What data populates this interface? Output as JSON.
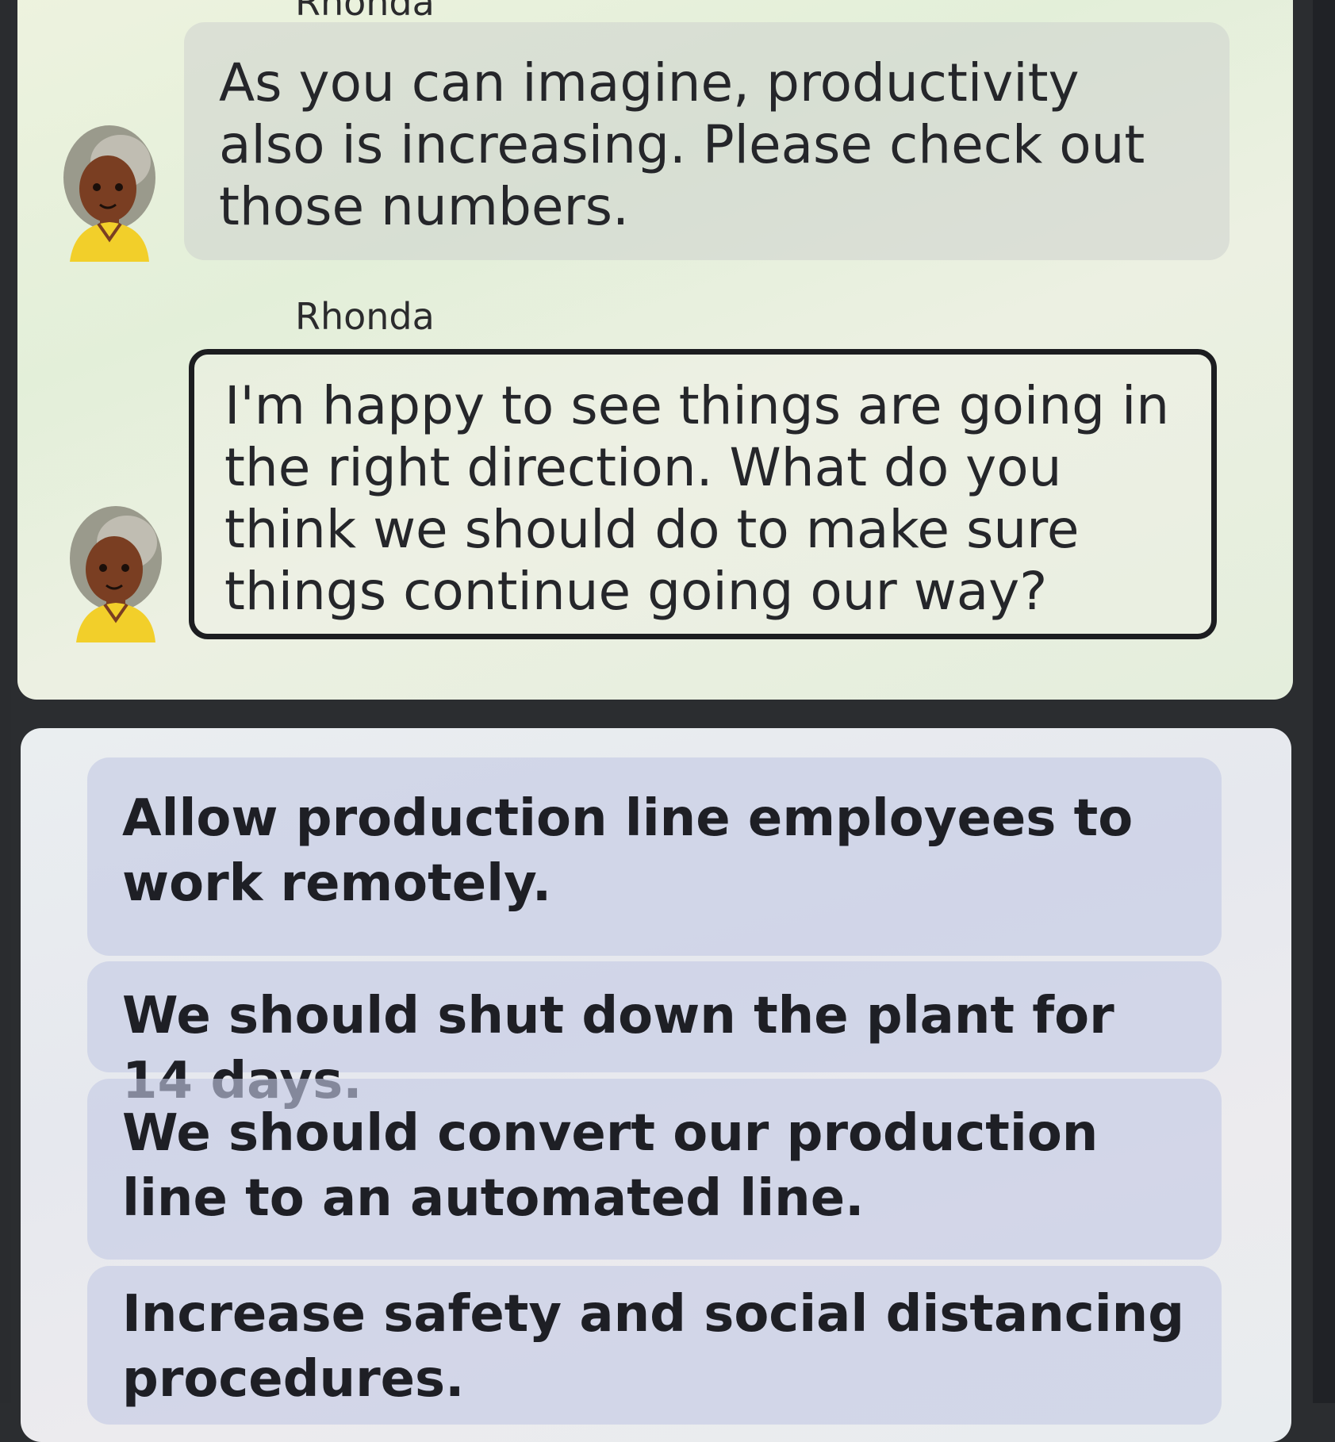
{
  "conversation": {
    "messages": [
      {
        "speaker": "Rhonda",
        "text": "As you can imagine, productivity also is increasing. Please check out those numbers."
      },
      {
        "speaker": "Rhonda",
        "text": "I'm happy to see things are going in the right direction. What do you think we should do to make sure things continue going our way?"
      }
    ]
  },
  "response_options": [
    {
      "text": "Allow production line employees to work remotely."
    },
    {
      "text": "We should shut down the plant for 14 days."
    },
    {
      "text": "We should convert our production line to an automated line."
    },
    {
      "text": "Increase safety and social distancing procedures."
    }
  ],
  "colors": {
    "chat_panel_bg": "#e6efda",
    "options_panel_bg": "#e8eaee",
    "option_bg": "#c4c9e4",
    "bubble_border": "#1c1d20",
    "avatar_skin": "#7a3e22",
    "avatar_hair": "#9a9a8c",
    "avatar_shirt": "#f2cf2a"
  },
  "icons": {
    "speaker_avatar": "woman-avatar-icon"
  }
}
